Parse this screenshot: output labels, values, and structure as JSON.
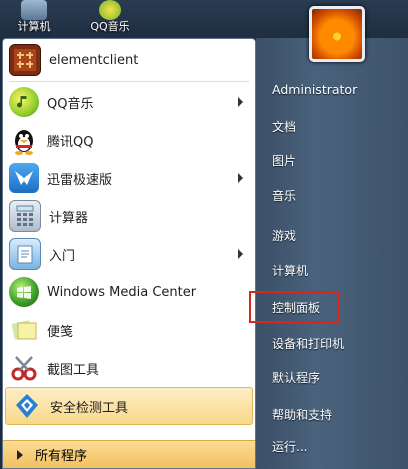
{
  "desktop": {
    "icons": [
      {
        "label": "计算机",
        "icon": "computer-icon"
      },
      {
        "label": "QQ音乐",
        "icon": "qq-music-icon"
      }
    ]
  },
  "start_menu": {
    "programs": [
      {
        "label": "elementclient",
        "icon": "elementclient-icon",
        "has_submenu": false
      },
      {
        "label": "QQ音乐",
        "icon": "qq-music-icon",
        "has_submenu": true
      },
      {
        "label": "腾讯QQ",
        "icon": "qq-penguin-icon",
        "has_submenu": false
      },
      {
        "label": "迅雷极速版",
        "icon": "thunder-bird-icon",
        "has_submenu": true
      },
      {
        "label": "计算器",
        "icon": "calculator-icon",
        "has_submenu": false
      },
      {
        "label": "入门",
        "icon": "getting-started-icon",
        "has_submenu": true
      },
      {
        "label": "Windows Media Center",
        "icon": "media-center-icon",
        "has_submenu": false
      },
      {
        "label": "便笺",
        "icon": "sticky-notes-icon",
        "has_submenu": false
      },
      {
        "label": "截图工具",
        "icon": "scissors-icon",
        "has_submenu": false
      },
      {
        "label": "安全检测工具",
        "icon": "security-check-icon",
        "has_submenu": false,
        "highlighted": true
      }
    ],
    "all_programs_label": "所有程序",
    "right_items": [
      {
        "label": "Administrator"
      },
      {
        "label": "文档"
      },
      {
        "label": "图片"
      },
      {
        "label": "音乐"
      },
      {
        "label": "游戏"
      },
      {
        "label": "计算机"
      },
      {
        "label": "控制面板",
        "annotated": true
      },
      {
        "label": "设备和打印机"
      },
      {
        "label": "默认程序"
      },
      {
        "label": "帮助和支持"
      },
      {
        "label": "运行..."
      }
    ],
    "annotation_color": "#d9261c",
    "highlight_color": "#f8d88a"
  }
}
